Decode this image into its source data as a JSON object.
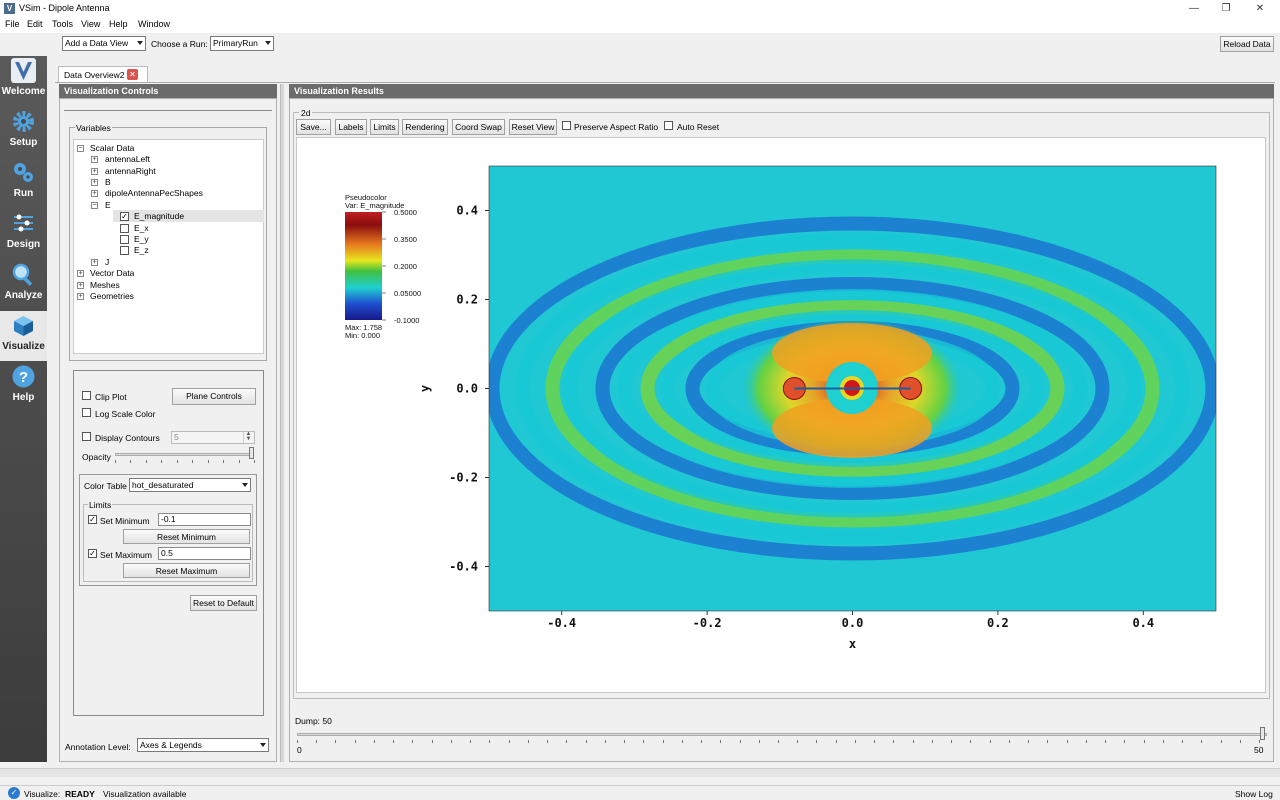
{
  "window": {
    "title": "VSim - Dipole Antenna",
    "logo_letter": "V",
    "btn_minimize": "—",
    "btn_restore": "❐",
    "btn_close": "✕"
  },
  "menu": [
    "File",
    "Edit",
    "Tools",
    "View",
    "Help",
    "Window"
  ],
  "toolbar": {
    "add_data_view": "Add a Data View",
    "choose_run_label": "Choose a Run:",
    "run_value": "PrimaryRun",
    "reload_data": "Reload Data"
  },
  "nav": [
    {
      "label": "Welcome",
      "icon": "vsim-logo-icon"
    },
    {
      "label": "Setup",
      "icon": "gear-icon"
    },
    {
      "label": "Run",
      "icon": "gears-icon"
    },
    {
      "label": "Design",
      "icon": "design-icon"
    },
    {
      "label": "Analyze",
      "icon": "magnifier-icon"
    },
    {
      "label": "Visualize",
      "icon": "cube-icon"
    },
    {
      "label": "Help",
      "icon": "question-icon"
    }
  ],
  "tab": {
    "label": "Data Overview2",
    "close": "✕"
  },
  "controls": {
    "header": "Visualization Controls",
    "variables_label": "Variables",
    "tree": [
      {
        "label": "Scalar Data",
        "sign": "−"
      },
      {
        "label": "antennaLeft",
        "sign": "+"
      },
      {
        "label": "antennaRight",
        "sign": "+"
      },
      {
        "label": "B",
        "sign": "+"
      },
      {
        "label": "dipoleAntennaPecShapes",
        "sign": "+"
      },
      {
        "label": "E",
        "sign": "−"
      },
      {
        "label": "E_magnitude",
        "checked": true
      },
      {
        "label": "E_x",
        "checked": false
      },
      {
        "label": "E_y",
        "checked": false
      },
      {
        "label": "E_z",
        "checked": false
      },
      {
        "label": "J",
        "sign": "+"
      },
      {
        "label": "Vector Data",
        "sign": "+"
      },
      {
        "label": "Meshes",
        "sign": "+"
      },
      {
        "label": "Geometries",
        "sign": "+"
      }
    ],
    "clip_plot": "Clip Plot",
    "plane_controls": "Plane Controls",
    "log_scale": "Log Scale Color",
    "display_contours": "Display Contours",
    "contours_value": "5",
    "opacity": "Opacity",
    "opacity_value": 1.0,
    "color_table_label": "Color Table",
    "color_table_value": "hot_desaturated",
    "limits_label": "Limits",
    "set_minimum": "Set Minimum",
    "min_value": "-0.1",
    "reset_minimum": "Reset Minimum",
    "set_maximum": "Set Maximum",
    "max_value": "0.5",
    "reset_maximum": "Reset Maximum",
    "reset_default": "Reset to Default",
    "annotation_label": "Annotation Level:",
    "annotation_value": "Axes & Legends"
  },
  "results": {
    "header": "Visualization Results",
    "group": "2d",
    "buttons": [
      "Save...",
      "Labels",
      "Limits",
      "Rendering",
      "Coord Swap",
      "Reset View"
    ],
    "preserve_aspect": "Preserve Aspect Ratio",
    "auto_reset": "Auto Reset",
    "dump_label": "Dump: 50",
    "slider_min": "0",
    "slider_max": "50",
    "dump_fraction": 1.0
  },
  "chart_data": {
    "type": "heatmap",
    "title": "",
    "xlabel": "x",
    "ylabel": "y",
    "xlim": [
      -0.5,
      0.5
    ],
    "ylim": [
      -0.5,
      0.5
    ],
    "x_ticks": [
      "-0.4",
      "-0.2",
      "0.0",
      "0.2",
      "0.4"
    ],
    "y_ticks": [
      "0.4",
      "0.2",
      "0.0",
      "-0.2",
      "-0.4"
    ],
    "legend": {
      "title": "Pseudocolor",
      "var": "Var: E_magnitude",
      "ticks": [
        "0.5000",
        "0.3500",
        "0.2000",
        "0.05000",
        "-0.1000"
      ],
      "max": "Max:  1.758",
      "min": "Min:  0.000"
    },
    "antenna_x": [
      -0.08,
      0.08
    ],
    "colorscale": [
      "#1a1f8f",
      "#1f6fd6",
      "#19c7d8",
      "#39d28a",
      "#6fd640",
      "#d8d81e",
      "#f2a020",
      "#e0502a",
      "#a51515"
    ]
  },
  "status": {
    "label": "Visualize:",
    "state": "READY",
    "message": "Visualization available",
    "show_log": "Show Log"
  }
}
